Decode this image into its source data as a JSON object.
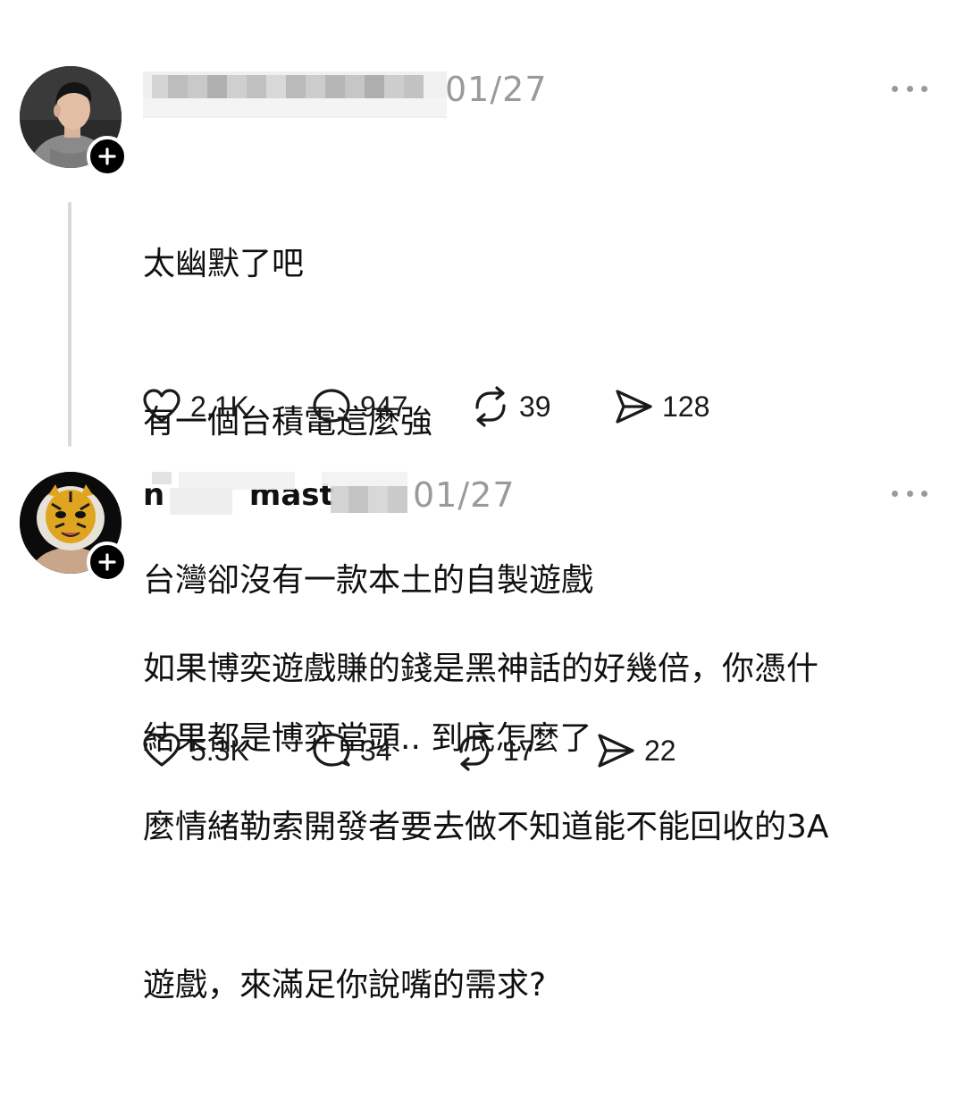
{
  "posts": [
    {
      "username": "",
      "date": "01/27",
      "lines": [
        "太幽默了吧",
        "有一個台積電這麼強",
        "台灣卻沒有一款本土的自製遊戲",
        "結果都是博弈當頭.. 到底怎麼了"
      ],
      "likes": "2.1K",
      "replies": "947",
      "reposts": "39",
      "shares": "128"
    },
    {
      "username": "n        mast",
      "date": "01/27",
      "lines": [
        "如果博奕遊戲賺的錢是黑神話的好幾倍，你憑什",
        "麼情緒勒索開發者要去做不知道能不能回收的3A",
        "遊戲，來滿足你說嘴的需求?"
      ],
      "likes": "5.3K",
      "replies": "34",
      "reposts": "17",
      "shares": "22"
    }
  ],
  "icons": {
    "like": "heart-icon",
    "reply": "comment-icon",
    "repost": "repost-icon",
    "share": "send-icon",
    "more": "more-horizontal-icon",
    "follow": "plus-icon"
  },
  "colors": {
    "text": "#101010",
    "muted": "#9a9a9a",
    "thread_line": "#d9d9d9"
  }
}
